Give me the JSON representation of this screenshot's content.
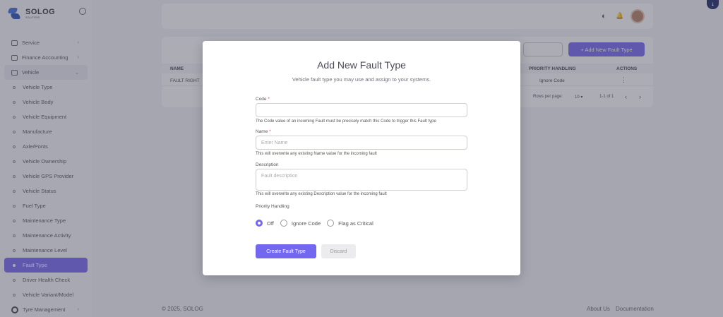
{
  "brand": {
    "name": "SOLOG",
    "tagline": "SOLUTIONS"
  },
  "sidebar": {
    "items": [
      {
        "label": "Service",
        "chevron": "›"
      },
      {
        "label": "Finance Accounting",
        "chevron": "›"
      },
      {
        "label": "Vehicle",
        "chevron": "⌄"
      },
      {
        "label": "Vehicle Type"
      },
      {
        "label": "Vehicle Body"
      },
      {
        "label": "Vehicle Equipment"
      },
      {
        "label": "Manufacture"
      },
      {
        "label": "Axle/Ponts"
      },
      {
        "label": "Vehicle Ownership"
      },
      {
        "label": "Vehicle GPS Provider"
      },
      {
        "label": "Vehicle Status"
      },
      {
        "label": "Fuel Type"
      },
      {
        "label": "Maintenance Type"
      },
      {
        "label": "Maintenance Activity"
      },
      {
        "label": "Maintenance Level"
      },
      {
        "label": "Fault Type"
      },
      {
        "label": "Driver Health Check"
      },
      {
        "label": "Vehicle Variant/Model"
      },
      {
        "label": "Tyre Management",
        "chevron": "›"
      }
    ]
  },
  "page": {
    "add_button": "+ Add New Fault Type",
    "columns": [
      "NAME",
      "PRIORITY HANDLING",
      "ACTIONS"
    ],
    "rows": [
      {
        "name": "FAULT RIGHT ",
        "priority": "Ignore Code",
        "actions": "⋮"
      }
    ],
    "pager": {
      "rows_label": "Rows per page:",
      "rows_value": "10 ▾",
      "range": "1-1 of 1",
      "prev": "‹",
      "next": "›"
    }
  },
  "footer": {
    "copyright": "© 2025, SOLOG",
    "about": "About Us",
    "docs": "Documentation"
  },
  "modal": {
    "title": "Add New Fault Type",
    "subtitle": "Vehicle fault type you may use and assign to your systems.",
    "code_label": "Code",
    "code_value": "",
    "code_hint": "The Code value of an incoming Fault must be precisely match this Code to trigger this Fault type",
    "name_label": "Name",
    "name_placeholder": "Enter Name",
    "name_hint": "This will overwrite any existing Name value for the incoming fault",
    "description_label": "Description",
    "description_placeholder": "Fault description",
    "description_hint": "This will overwrite any existing Description value for the incoming fault",
    "priority_label": "Priority Handling",
    "priority_options": [
      "Off",
      "Ignore Code",
      "Flag as Critical"
    ],
    "priority_selected": "Off",
    "required_mark": "*",
    "create_button": "Create Fault Type",
    "discard_button": "Discard"
  },
  "topbar": {
    "theme_icon": "◐",
    "bell_icon": "🔔"
  },
  "corner_badge": "↓",
  "colors": {
    "accent": "#7367f0"
  }
}
